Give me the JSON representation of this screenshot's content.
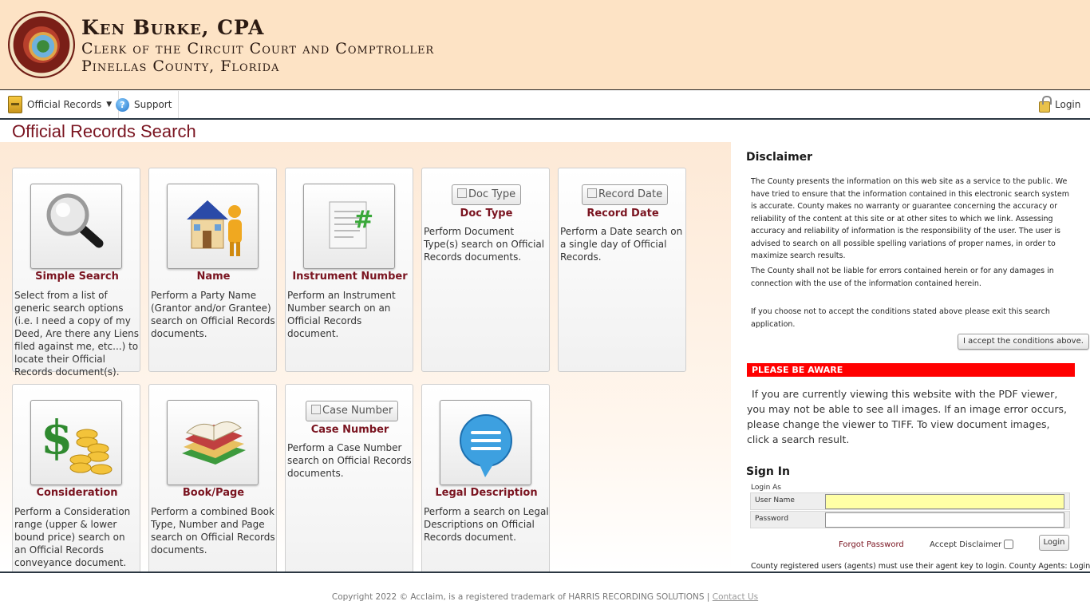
{
  "header": {
    "name": "Ken Burke, CPA",
    "office": "Clerk of the Circuit Court and Comptroller",
    "county": "Pinellas County, Florida"
  },
  "nav": {
    "official_records": "Official Records",
    "support": "Support",
    "login": "Login"
  },
  "page": {
    "title": "Official Records Search"
  },
  "cards": [
    {
      "title": "Simple Search",
      "desc": "Select from a list of generic search options (i.e. I need a copy of my Deed, Are there any Liens filed against me, etc...) to locate their Official Records document(s)."
    },
    {
      "title": "Name",
      "desc": "Perform a Party Name (Grantor and/or Grantee) search on Official Records documents."
    },
    {
      "title": "Instrument Number",
      "desc": "Perform an Instrument Number search on an Official Records document."
    },
    {
      "title": "Doc Type",
      "button": "Doc Type",
      "desc": "Perform Document Type(s) search on Official Records documents."
    },
    {
      "title": "Record Date",
      "button": "Record Date",
      "desc": "Perform a Date search on a single day of Official Records."
    },
    {
      "title": "Consideration",
      "desc": "Perform a Consideration range (upper & lower bound price) search on an Official Records conveyance document."
    },
    {
      "title": "Book/Page",
      "desc": "Perform a combined Book Type, Number and Page search on Official Records documents."
    },
    {
      "title": "Case Number",
      "button": "Case Number",
      "desc": "Perform a Case Number search on Official Records documents."
    },
    {
      "title": "Legal Description",
      "desc": "Perform a search on Legal Descriptions on Official Records document."
    }
  ],
  "disclaimer": {
    "title": "Disclaimer",
    "p1": "The County presents the information on this web site as a service to the public. We have tried to ensure that the information contained in this electronic search system is accurate. County makes no warranty or guarantee concerning the accuracy or reliability of the content at this site or at other sites to which we link. Assessing accuracy and reliability of information is the responsibility of the user. The user is advised to search on all possible spelling variations of proper names, in order to maximize search results.",
    "p2": "The County shall not be liable for errors contained herein or for any damages in connection with the use of the information contained herein.",
    "p3": "If you choose not to accept the conditions stated above please exit this search application.",
    "accept_button": "I accept the conditions above."
  },
  "aware": {
    "title": "PLEASE BE AWARE",
    "text": "If you are currently viewing this website with the PDF viewer, you may not be able to see all images. If an image error occurs, please change the viewer to TIFF. To view document images, click a search result."
  },
  "signin": {
    "title": "Sign In",
    "login_as": "Login As",
    "username_label": "User Name",
    "password_label": "Password",
    "username_value": "",
    "password_value": "",
    "forgot": "Forgot Password",
    "accept_disclaimer": "Accept Disclaimer",
    "login_button": "Login",
    "agents_note": "County registered users (agents) must use their agent key to login. County Agents: Login"
  },
  "footer": {
    "copyright": "Copyright 2022 © Acclaim, is a registered trademark of HARRIS RECORDING SOLUTIONS |",
    "contact": "Contact Us"
  }
}
